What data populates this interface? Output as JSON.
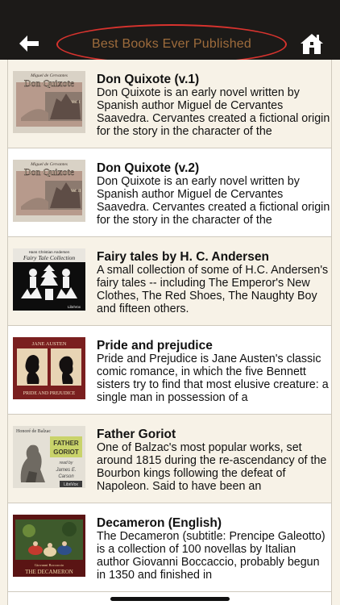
{
  "header": {
    "title": "Best Books Ever Published",
    "back_icon": "arrow-left-icon",
    "home_icon": "home-icon",
    "background": "#1c1a18",
    "title_color": "#9e6c3c",
    "highlight_color": "#d8332e"
  },
  "books": [
    {
      "title": "Don Quixote (v.1)",
      "description": "Don Quixote is an early novel written by Spanish author Miguel de Cervantes Saavedra. Cervantes created a fictional origin for the story in the character of the",
      "cover_author": "Miguel de Cervantes",
      "cover_title": "Don Quixote",
      "cover_volume": "Vol. I"
    },
    {
      "title": "Don Quixote (v.2)",
      "description": "Don Quixote is an early novel written by Spanish author Miguel de Cervantes Saavedra. Cervantes created a fictional origin for the story in the character of the",
      "cover_author": "Miguel de Cervantes",
      "cover_title": "Don Quixote",
      "cover_volume": "Vol. II"
    },
    {
      "title": "Fairy tales by H. C. Andersen",
      "description": "A small collection of some of H.C. Andersen's fairy tales -- including The Emperor's New Clothes, The Red Shoes, The Naughty Boy and fifteen others.",
      "cover_author": "Hans Christian Andersen",
      "cover_title": "Fairy Tale Collection",
      "cover_badge": "LibriVox"
    },
    {
      "title": "Pride and prejudice",
      "description": "Pride and Prejudice is Jane Austen's classic comic romance, in which the five Bennett sisters try to find that most elusive creature: a single man in possession of a",
      "cover_author": "JANE AUSTEN",
      "cover_title": "PRIDE AND PREJUDICE"
    },
    {
      "title": "Father Goriot",
      "description": "One of Balzac's most popular works, set around 1815 during the re-ascendancy of the Bourbon kings following the defeat of Napoleon. Said to have been an",
      "cover_author": "Honoré de Balzac",
      "cover_title_1": "FATHER",
      "cover_title_2": "GORIOT",
      "cover_reader_1": "read by",
      "cover_reader_2": "James E.",
      "cover_reader_3": "Carson",
      "cover_badge": "LibriVox"
    },
    {
      "title": "Decameron (English)",
      "description": "The Decameron (subtitle: Prencipe Galeotto) is a collection of 100 novellas by Italian author Giovanni Boccaccio, probably begun in 1350 and finished in",
      "cover_author": "Giovanni Boccaccio",
      "cover_title": "THE DECAMERON"
    }
  ]
}
